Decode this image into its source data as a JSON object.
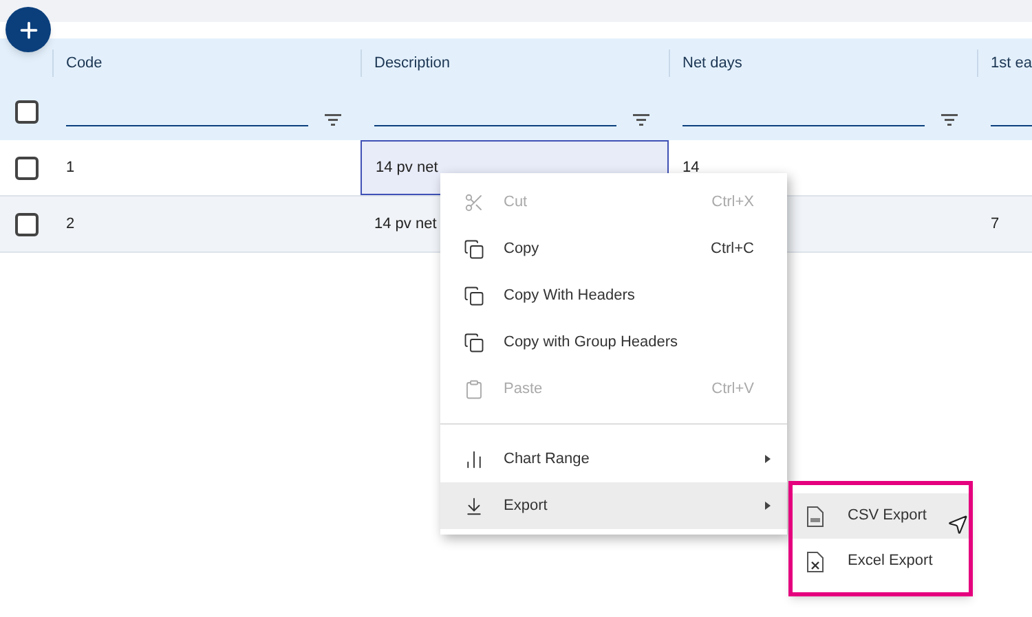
{
  "select_all": {
    "checked": false
  },
  "columns": [
    {
      "label": "Code"
    },
    {
      "label": "Description"
    },
    {
      "label": "Net days"
    },
    {
      "label": "1st ea"
    }
  ],
  "rows": [
    {
      "checked": false,
      "cells": [
        {
          "text": "1",
          "focused": false
        },
        {
          "text": "14 pv net",
          "focused": true
        },
        {
          "text": "14",
          "focused": false
        },
        {
          "text": "",
          "focused": false
        }
      ]
    },
    {
      "checked": false,
      "cells": [
        {
          "text": "2",
          "focused": false
        },
        {
          "text": "14 pv net",
          "focused": false
        },
        {
          "text": "",
          "focused": false
        },
        {
          "text": "7",
          "focused": false
        }
      ]
    }
  ],
  "context_menu": [
    {
      "kind": "cut",
      "label": "Cut",
      "shortcut": "Ctrl+X",
      "disabled": true,
      "submenu": false,
      "selected": false
    },
    {
      "kind": "copy",
      "label": "Copy",
      "shortcut": "Ctrl+C",
      "disabled": false,
      "submenu": false,
      "selected": false
    },
    {
      "kind": "copy",
      "label": "Copy With Headers",
      "disabled": false,
      "submenu": false,
      "selected": false
    },
    {
      "kind": "copy",
      "label": "Copy with Group Headers",
      "disabled": false,
      "submenu": false,
      "selected": false
    },
    {
      "kind": "paste",
      "label": "Paste",
      "shortcut": "Ctrl+V",
      "disabled": true,
      "submenu": false,
      "selected": false
    },
    {
      "kind": "separator"
    },
    {
      "kind": "chart",
      "label": "Chart Range",
      "disabled": false,
      "submenu": true,
      "selected": false
    },
    {
      "kind": "export",
      "label": "Export",
      "disabled": false,
      "submenu": true,
      "selected": true
    }
  ],
  "submenu": [
    {
      "kind": "csv",
      "label": "CSV Export",
      "selected": true
    },
    {
      "kind": "excel",
      "label": "Excel Export",
      "selected": false
    }
  ]
}
